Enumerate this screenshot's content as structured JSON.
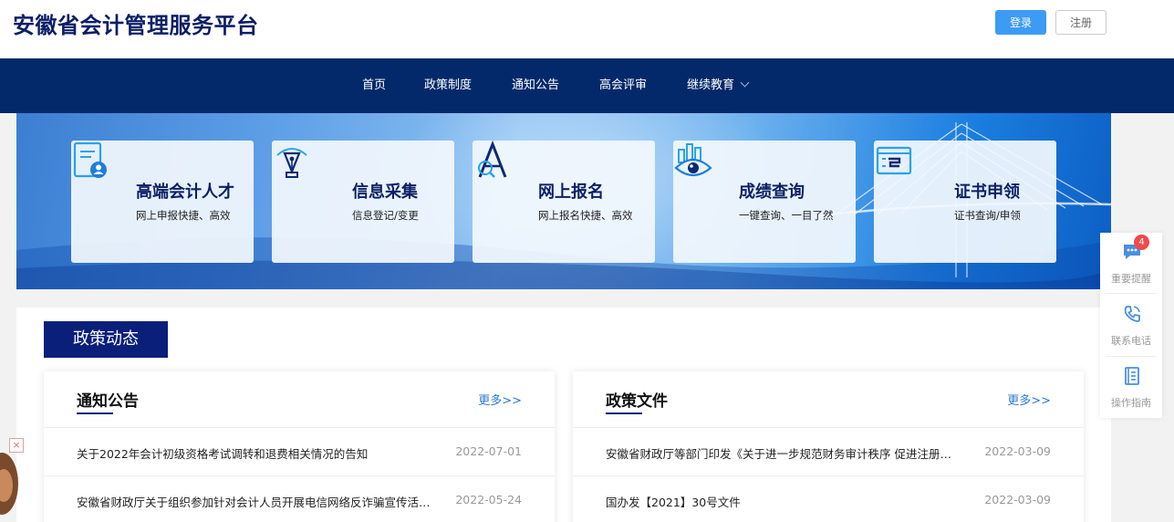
{
  "header": {
    "site_title": "安徽省会计管理服务平台",
    "login_label": "登录",
    "register_label": "注册"
  },
  "nav": {
    "items": [
      {
        "label": "首页"
      },
      {
        "label": "政策制度"
      },
      {
        "label": "通知公告"
      },
      {
        "label": "高会评审"
      },
      {
        "label": "继续教育",
        "has_dropdown": true
      }
    ]
  },
  "banner": {
    "cards": [
      {
        "icon": "person-document-icon",
        "title": "高端会计人才",
        "subtitle": "网上申报快捷、高效"
      },
      {
        "icon": "pen-nib-icon",
        "title": "信息采集",
        "subtitle": "信息登记/变更"
      },
      {
        "icon": "letter-a-icon",
        "title": "网上报名",
        "subtitle": "网上报名快捷、高效"
      },
      {
        "icon": "eye-chart-icon",
        "title": "成绩查询",
        "subtitle": "一键查询、一目了然"
      },
      {
        "icon": "certificate-icon",
        "title": "证书申领",
        "subtitle": "证书查询/申领"
      }
    ]
  },
  "section": {
    "title": "政策动态"
  },
  "panels": [
    {
      "title": "通知公告",
      "more_label": "更多>>",
      "items": [
        {
          "text": "关于2022年会计初级资格考试调转和退费相关情况的告知",
          "date": "2022-07-01"
        },
        {
          "text": "安徽省财政厅关于组织参加针对会计人员开展电信网络反诈骗宣传活动的通知",
          "date": "2022-05-24"
        }
      ]
    },
    {
      "title": "政策文件",
      "more_label": "更多>>",
      "items": [
        {
          "text": "安徽省财政厅等部门印发《关于进一步规范财务审计秩序 促进注册会计师行业健康发展的实施意见》",
          "date": "2022-03-09"
        },
        {
          "text": "国办发【2021】30号文件",
          "date": "2022-03-09"
        }
      ]
    }
  ],
  "side_float": {
    "items": [
      {
        "icon": "chat-bubble-icon",
        "label": "重要提醒",
        "badge": "4"
      },
      {
        "icon": "phone-icon",
        "label": "联系电话"
      },
      {
        "icon": "guide-book-icon",
        "label": "操作指南"
      }
    ]
  },
  "float_ad": {
    "close_label": "×"
  },
  "colors": {
    "nav_bg": "#04296a",
    "title_color": "#0b1f66",
    "primary_button": "#3d9bf5",
    "section_badge": "#0a1f7a",
    "more_link": "#2b7bd6",
    "side_icon": "#4a8fe0",
    "badge_red": "#f04a4a"
  }
}
